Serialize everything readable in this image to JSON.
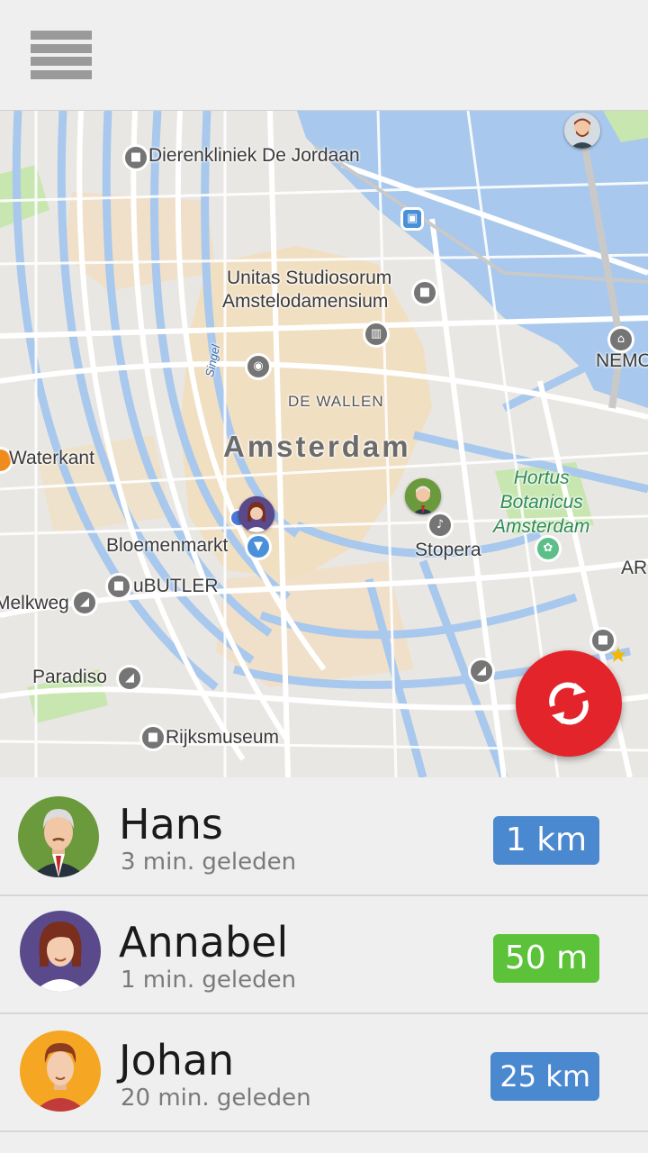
{
  "colors": {
    "blue_badge": "#4a88cf",
    "green_badge": "#5cc23a",
    "refresh": "#e4242b",
    "water": "#a8c8ed"
  },
  "topbar": {
    "menu_icon": "hamburger-menu-icon"
  },
  "map": {
    "labels": {
      "dierenkliniek": "Dierenkliniek De Jordaan",
      "unitas_1": "Unitas Studiosorum",
      "unitas_2": "Amstelodamensium",
      "de_wallen": "DE WALLEN",
      "amsterdam": "Amsterdam",
      "waterkant": "Waterkant",
      "hortus_1": "Hortus",
      "hortus_2": "Botanicus",
      "hortus_3": "Amsterdam",
      "bloemenmarkt": "Bloemenmarkt",
      "stopera": "Stopera",
      "ubutler": "uBUTLER",
      "melkweg": "Melkweg",
      "paradiso": "Paradiso",
      "rijksmuseum": "Rijksmuseum",
      "nemo": "NEMO",
      "ar": "AR",
      "singel": "Singel"
    },
    "refresh_icon": "refresh-icon"
  },
  "people": [
    {
      "name": "Hans",
      "time": "3 min. geleden",
      "distance": "1 km",
      "badge_color": "#4a88cf"
    },
    {
      "name": "Annabel",
      "time": "1 min. geleden",
      "distance": "50 m",
      "badge_color": "#5cc23a"
    },
    {
      "name": "Johan",
      "time": "20 min. geleden",
      "distance": "25 km",
      "badge_color": "#4a88cf"
    }
  ]
}
